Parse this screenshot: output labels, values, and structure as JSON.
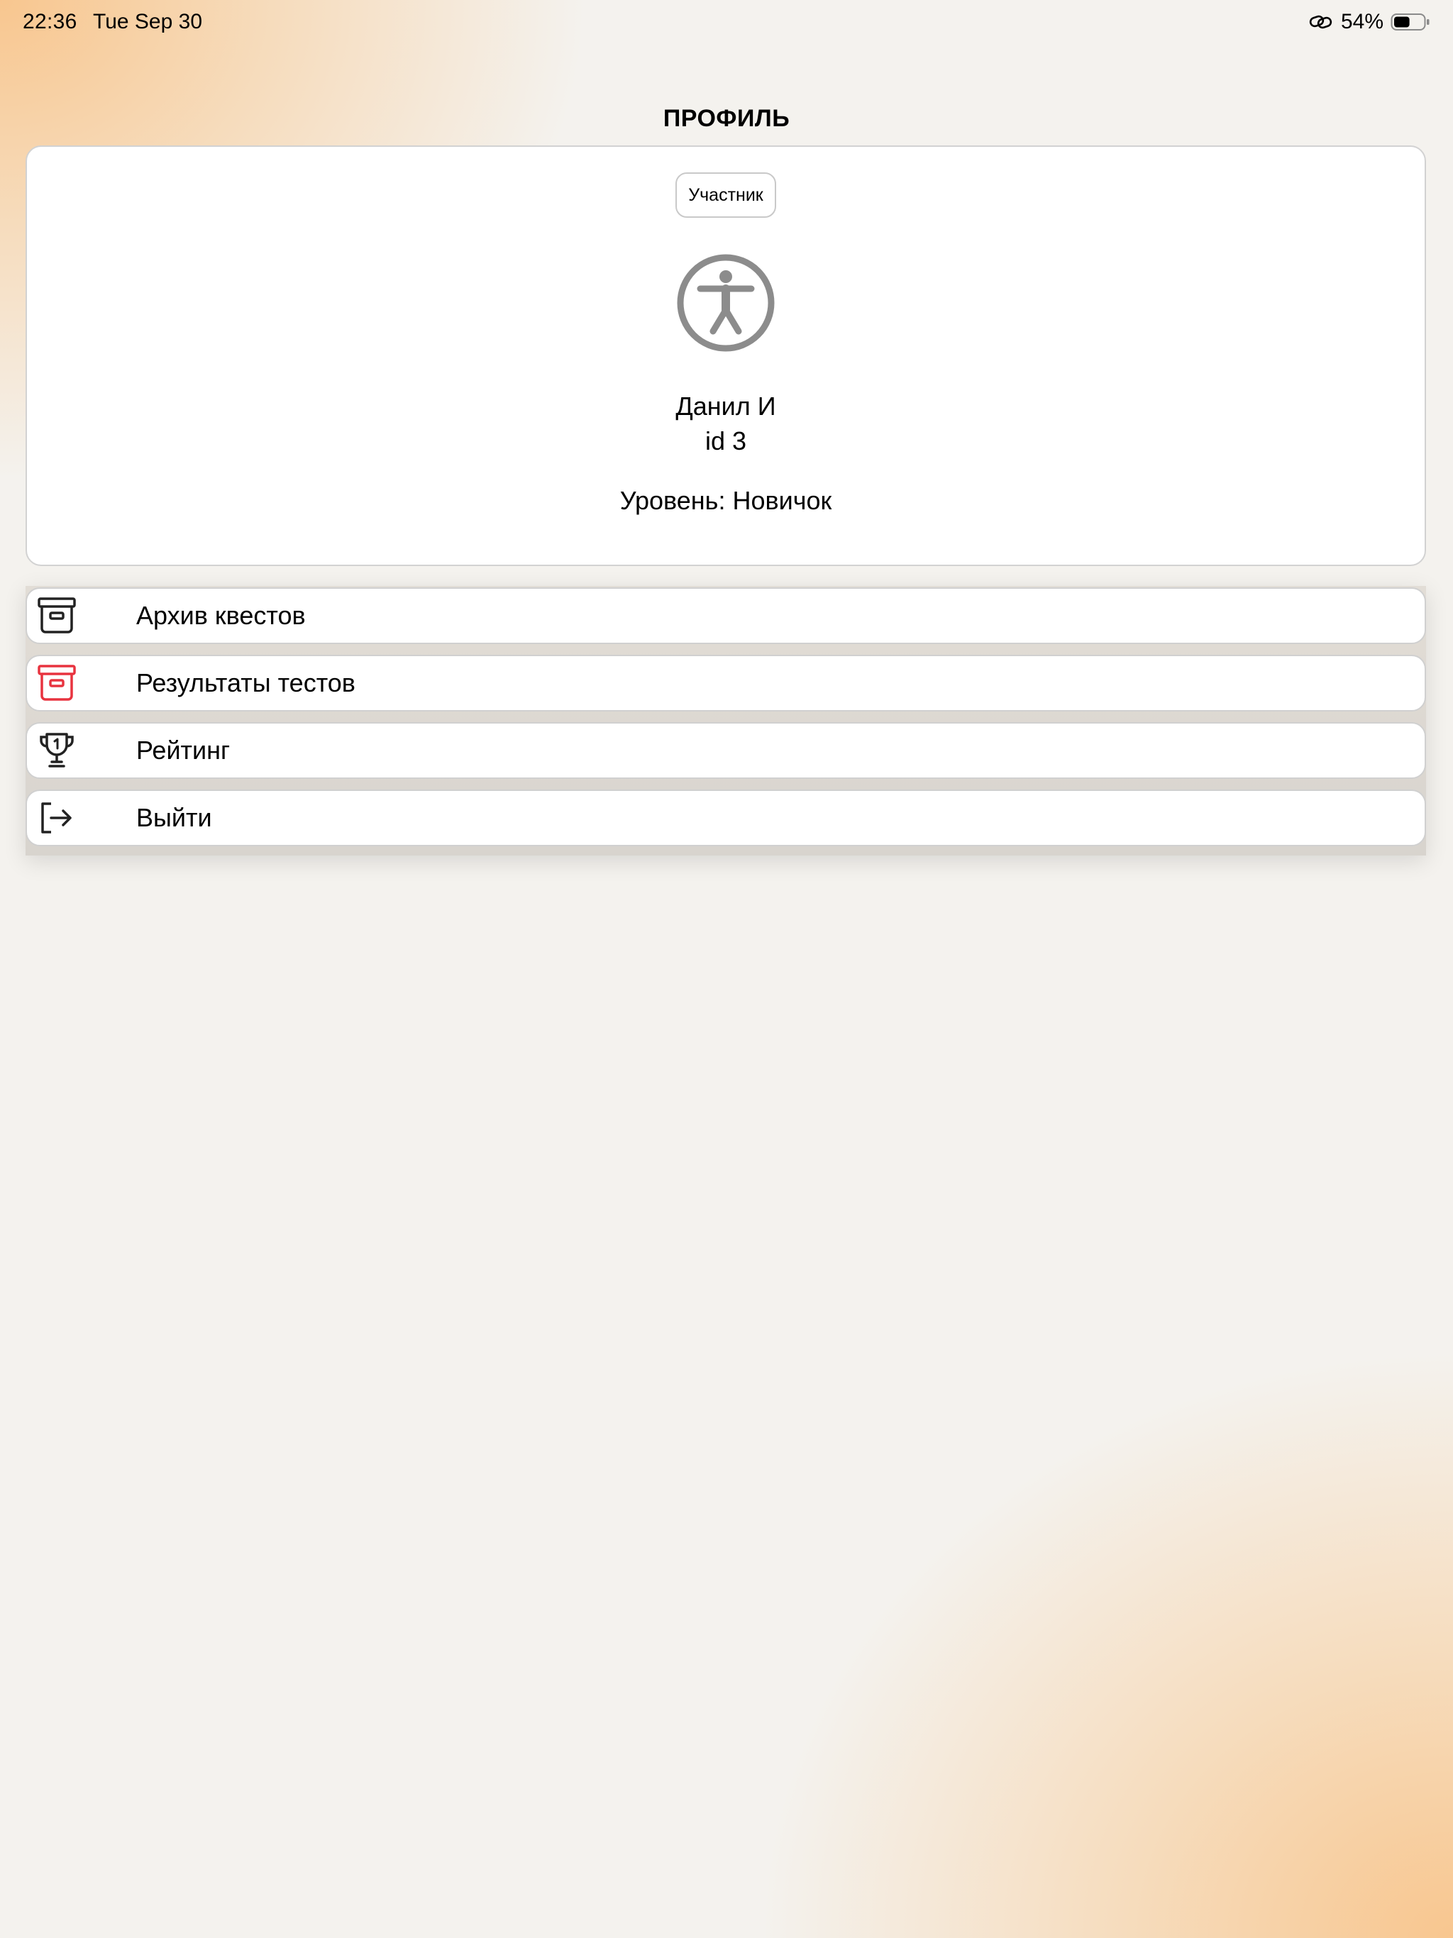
{
  "status_bar": {
    "time": "22:36",
    "date": "Tue Sep 30",
    "battery_percent": "54%",
    "battery_level": 0.54,
    "icons": [
      "link-icon",
      "battery-icon"
    ]
  },
  "page": {
    "title": "ПРОФИЛЬ"
  },
  "profile": {
    "role": "Участник",
    "avatar_icon": "accessibility-person-icon",
    "name": "Данил И",
    "id_text": "id 3",
    "level_text": "Уровень: Новичок"
  },
  "menu": {
    "items": [
      {
        "label": "Архив квестов",
        "icon": "archive-box-icon",
        "icon_color": "#222222"
      },
      {
        "label": "Результаты тестов",
        "icon": "archive-box-icon",
        "icon_color": "#e8333f"
      },
      {
        "label": "Рейтинг",
        "icon": "trophy-icon",
        "icon_color": "#222222"
      },
      {
        "label": "Выйти",
        "icon": "logout-icon",
        "icon_color": "#222222"
      }
    ]
  },
  "colors": {
    "background": "#f4f2ee",
    "accent_gradient": "#f8c48a",
    "card": "#ffffff",
    "danger_icon": "#e8333f"
  }
}
